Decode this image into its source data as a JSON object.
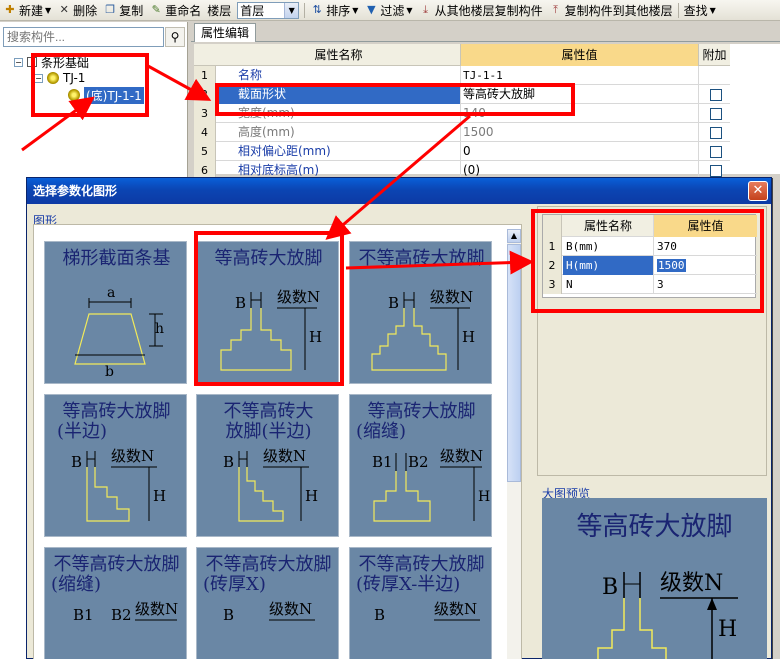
{
  "toolbar": {
    "new": "新建",
    "delete": "删除",
    "copy": "复制",
    "rename": "重命名",
    "floor_label": "楼层",
    "floor_value": "首层",
    "sort": "排序",
    "filter": "过滤",
    "copy_from": "从其他楼层复制构件",
    "copy_to": "复制构件到其他楼层",
    "find": "查找"
  },
  "search": {
    "placeholder": "搜索构件..."
  },
  "tree": {
    "root": "条形基础",
    "child": "TJ-1",
    "leaf": "(底)TJ-1-1"
  },
  "tab": "属性编辑",
  "grid": {
    "headers": {
      "name": "属性名称",
      "value": "属性值",
      "extra": "附加"
    },
    "rows": [
      {
        "num": "1",
        "name": "名称",
        "value": "TJ-1-1"
      },
      {
        "num": "2",
        "name": "截面形状",
        "value": "等高砖大放脚"
      },
      {
        "num": "3",
        "name": "宽度(mm)",
        "value": "140"
      },
      {
        "num": "4",
        "name": "高度(mm)",
        "value": "1500"
      },
      {
        "num": "5",
        "name": "相对偏心距(mm)",
        "value": "0"
      },
      {
        "num": "6",
        "name": "相对底标高(m)",
        "value": "(0)"
      }
    ]
  },
  "dialog": {
    "title": "选择参数化图形",
    "close": "✕",
    "shapes_label": "图形",
    "tiles": [
      {
        "title1": "梯形截面条基",
        "title2": ""
      },
      {
        "title1": "等高砖大放脚",
        "title2": ""
      },
      {
        "title1": "不等高砖大放脚",
        "title2": ""
      },
      {
        "title1": "等高砖大放脚",
        "title2": "(半边)"
      },
      {
        "title1": "不等高砖大",
        "title2": "放脚(半边)"
      },
      {
        "title1": "等高砖大放脚",
        "title2": "(缩缝)"
      },
      {
        "title1": "不等高砖大放脚",
        "title2": "(缩缝)"
      },
      {
        "title1": "不等高砖大放脚",
        "title2": "(砖厚X)"
      },
      {
        "title1": "不等高砖大放脚",
        "title2": "(砖厚X-半边)"
      }
    ],
    "labels": {
      "a": "a",
      "b": "b",
      "h": "h",
      "B": "B",
      "N": "级数N",
      "H": "H",
      "B1": "B1",
      "B2": "B2"
    },
    "params": {
      "headers": {
        "name": "属性名称",
        "value": "属性值"
      },
      "rows": [
        {
          "num": "1",
          "name": "B(mm)",
          "value": "370"
        },
        {
          "num": "2",
          "name": "H(mm)",
          "value": "1500"
        },
        {
          "num": "3",
          "name": "N",
          "value": "3"
        }
      ]
    },
    "preview_label": "大图预览",
    "preview_title": "等高砖大放脚"
  }
}
